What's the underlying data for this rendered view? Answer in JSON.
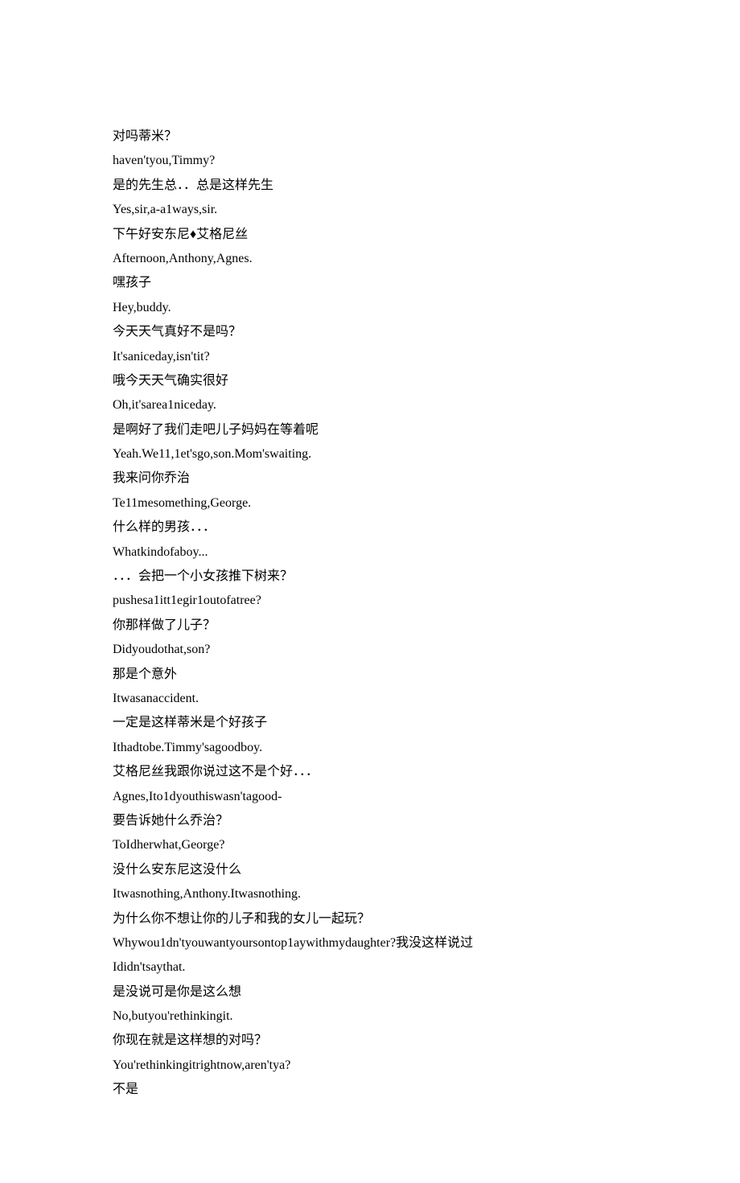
{
  "lines": [
    "对吗蒂米？",
    "haven'tyou,Timmy?",
    "是的先生总．．总是这样先生",
    "Yes,sir,a-a1ways,sir.",
    "下午好安东尼♦艾格尼丝",
    "Afternoon,Anthony,Agnes.",
    "嘿孩子",
    "Hey,buddy.",
    "今天天气真好不是吗？",
    "It'saniceday,isn'tit?",
    "哦今天天气确实很好",
    "Oh,it'sarea1niceday.",
    "是啊好了我们走吧儿子妈妈在等着呢",
    "Yeah.We11,1et'sgo,son.Mom'swaiting.",
    "我来问你乔治",
    "Te11mesomething,George.",
    "什么样的男孩．．．",
    "Whatkindofaboy...",
    "．．．会把一个小女孩推下树来？",
    "pushesa1itt1egir1outofatree?",
    "你那样做了儿子？",
    "Didyoudothat,son?",
    "那是个意外",
    "Itwasanaccident.",
    "一定是这样蒂米是个好孩子",
    "Ithadtobe.Timmy'sagoodboy.",
    "艾格尼丝我跟你说过这不是个好．．．",
    "Agnes,Ito1dyouthiswasn'tagood-",
    "要告诉她什么乔治？",
    "ToIdherwhat,George?",
    "没什么安东尼这没什么",
    "Itwasnothing,Anthony.Itwasnothing.",
    "为什么你不想让你的儿子和我的女儿一起玩？",
    "Whywou1dn'tyouwantyoursontop1aywithmydaughter?我没这样说过",
    "Ididn'tsaythat.",
    "是没说可是你是这么想",
    "No,butyou'rethinkingit.",
    "你现在就是这样想的对吗？",
    "You'rethinkingitrightnow,aren'tya?",
    "不是"
  ]
}
